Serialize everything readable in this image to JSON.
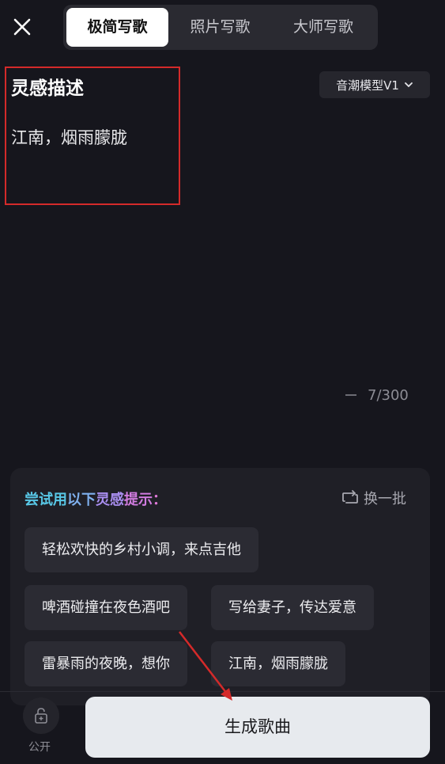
{
  "nav": {
    "close_icon": "close-icon",
    "tabs": [
      {
        "label": "极简写歌",
        "active": true
      },
      {
        "label": "照片写歌",
        "active": false
      },
      {
        "label": "大师写歌",
        "active": false
      }
    ]
  },
  "editor": {
    "title": "灵感描述",
    "description": "江南，烟雨朦胧",
    "model_label": "音潮模型V1",
    "model_icon": "chevron-down-icon",
    "counter": "7/300"
  },
  "suggestions": {
    "hint_parts": [
      "尝试用",
      "以下",
      "灵感",
      "提示",
      "："
    ],
    "refresh_label": "换一批",
    "refresh_icon": "refresh-icon",
    "chips": [
      "轻松欢快的乡村小调，来点吉他",
      "啤酒碰撞在夜色酒吧",
      "写给妻子，传达爱意",
      "雷暴雨的夜晚，想你",
      "江南，烟雨朦胧"
    ]
  },
  "footer": {
    "lock_icon": "lock-icon",
    "public_label": "公开",
    "generate_label": "生成歌曲"
  },
  "colors": {
    "background": "#16161d",
    "annotation": "#d42a2a",
    "gradient": [
      "#58c7e6",
      "#8d8ef0",
      "#e07ad8"
    ]
  }
}
